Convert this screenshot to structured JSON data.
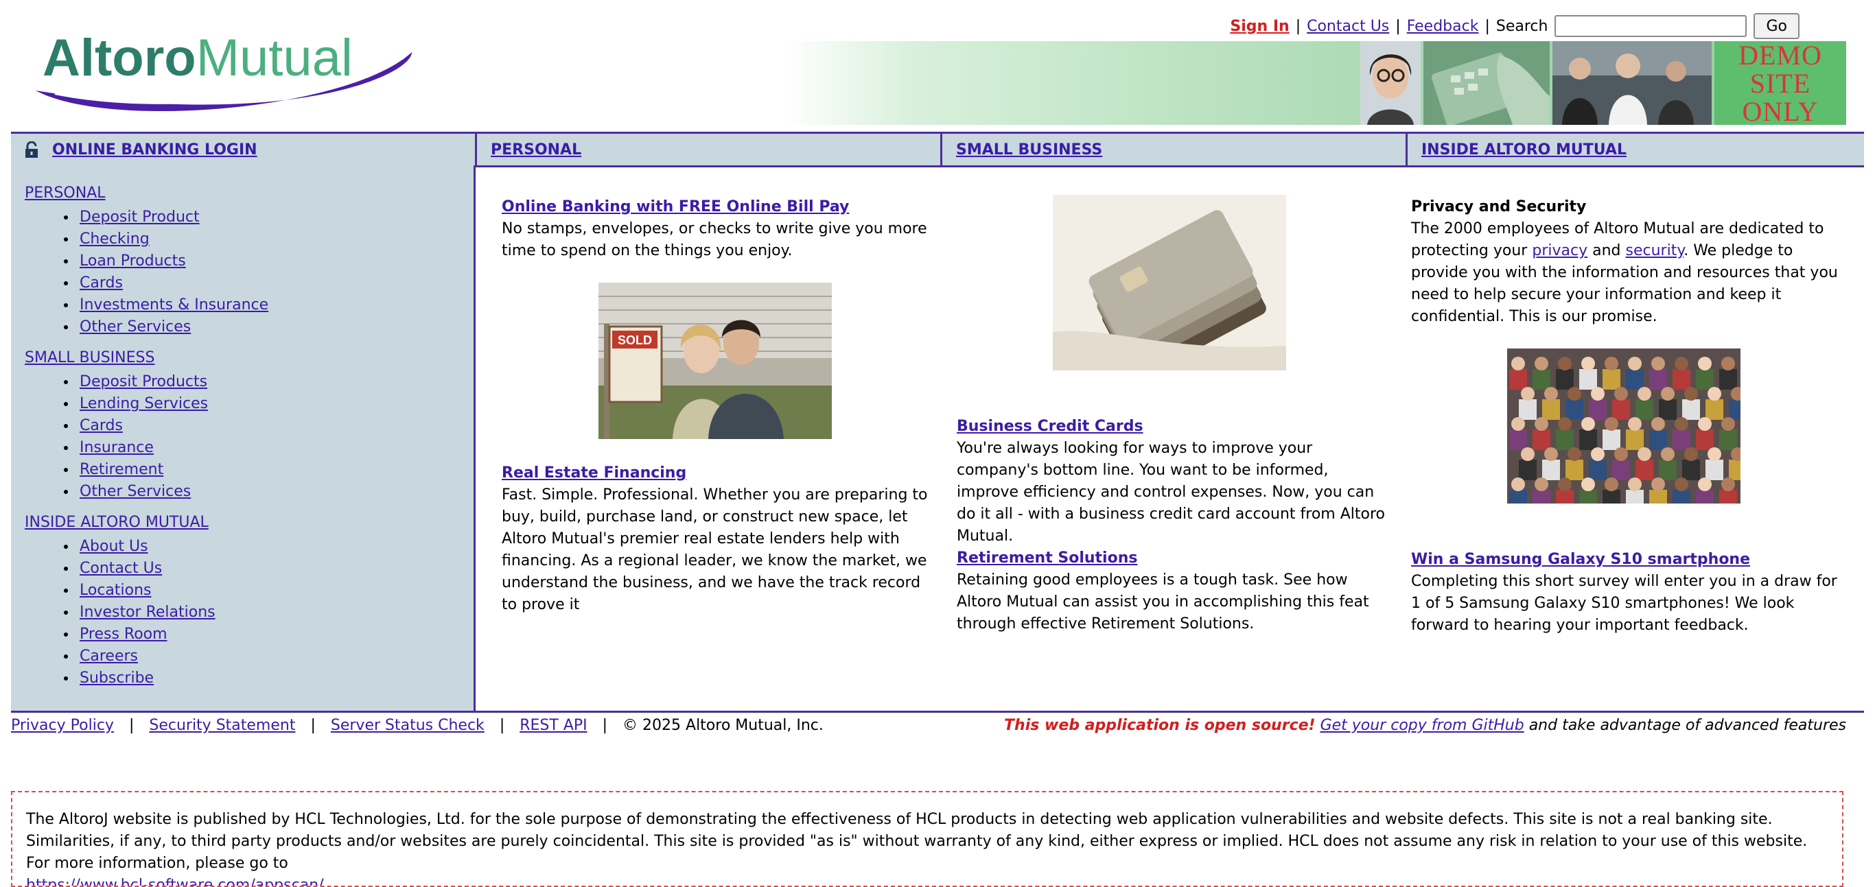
{
  "header": {
    "logo_word1": "Altoro",
    "logo_word2": "Mutual",
    "sign_in": "Sign In",
    "contact_us": "Contact Us",
    "feedback": "Feedback",
    "search_label": "Search",
    "search_value": "",
    "go_label": "Go",
    "separator": "|",
    "banner_text": "DEMO\nSITE\nONLY",
    "brand_colors": {
      "logo_teal": "#2E7D6B",
      "logo_green": "#4CAF80",
      "swoosh": "#4B1FA6"
    }
  },
  "tabs": {
    "login": "ONLINE BANKING LOGIN",
    "personal": "PERSONAL",
    "small_business": "SMALL BUSINESS",
    "inside": "INSIDE ALTORO MUTUAL"
  },
  "sidebar": {
    "personal": {
      "heading": "PERSONAL",
      "items": [
        "Deposit Product",
        "Checking",
        "Loan Products",
        "Cards",
        "Investments & Insurance",
        "Other Services"
      ]
    },
    "small_business": {
      "heading": "SMALL BUSINESS",
      "items": [
        "Deposit Products",
        "Lending Services",
        "Cards",
        "Insurance",
        "Retirement",
        "Other Services"
      ]
    },
    "inside": {
      "heading": "INSIDE ALTORO MUTUAL",
      "items": [
        "About Us",
        "Contact Us",
        "Locations",
        "Investor Relations",
        "Press Room",
        "Careers",
        "Subscribe"
      ]
    }
  },
  "personal_col": {
    "online_banking_title": "Online Banking with FREE Online Bill Pay",
    "online_banking_text": "No stamps, envelopes, or checks to write give you more time to spend on the things you enjoy.",
    "sold_sign": "SOLD",
    "real_estate_title": "Real Estate Financing",
    "real_estate_text": "Fast. Simple. Professional. Whether you are preparing to buy, build, purchase land, or construct new space, let Altoro Mutual's premier real estate lenders help with financing. As a regional leader, we know the market, we understand the business, and we have the track record to prove it"
  },
  "business_col": {
    "credit_cards_title": "Business Credit Cards",
    "credit_cards_text": "You're always looking for ways to improve your company's bottom line. You want to be informed, improve efficiency and control expenses. Now, you can do it all - with a business credit card account from Altoro Mutual.",
    "retirement_title": "Retirement Solutions",
    "retirement_text": "Retaining good employees is a tough task. See how Altoro Mutual can assist you in accomplishing this feat through effective Retirement Solutions."
  },
  "inside_col": {
    "privacy_title": "Privacy and Security",
    "privacy_text1": "The 2000 employees of Altoro Mutual are dedicated to protecting your",
    "privacy_link": "privacy",
    "and_word": "and",
    "security_link": "security",
    "privacy_text2": ". We pledge to provide you with the information and resources that you need to help secure your information and keep it confidential. This is our promise.",
    "samsung_title": "Win a Samsung Galaxy S10 smartphone",
    "samsung_text": "Completing this short survey will enter you in a draw for 1 of 5 Samsung Galaxy S10 smartphones! We look forward to hearing your important feedback."
  },
  "footer": {
    "privacy_policy": "Privacy Policy",
    "security_statement": "Security Statement",
    "server_status": "Server Status Check",
    "rest_api": "REST API",
    "copyright": "© 2025 Altoro Mutual, Inc.",
    "oss_highlight": "This web application is open source!",
    "oss_link": "Get your copy from GitHub",
    "oss_tail": "and take advantage of advanced features",
    "separator": "|"
  },
  "disclaimer": {
    "text": "The AltoroJ website is published by HCL Technologies, Ltd. for the sole purpose of demonstrating the effectiveness of HCL products in detecting web application vulnerabilities and website defects. This site is not a real banking site. Similarities, if any, to third party products and/or websites are purely coincidental. This site is provided \"as is\" without warranty of any kind, either express or implied. HCL does not assume any risk in relation to your use of this website. For more information, please go to",
    "link": "https://www.hcl-software.com/appscan/"
  }
}
